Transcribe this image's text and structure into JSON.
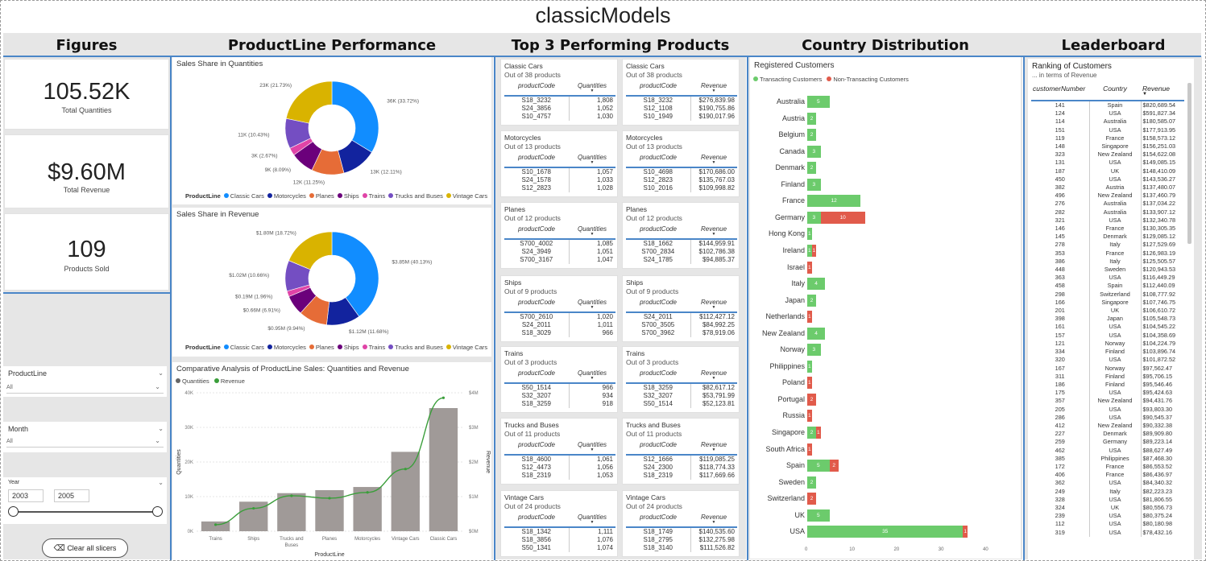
{
  "app_title": "classicModels",
  "headers": {
    "figures": "Figures",
    "productline": "ProductLine Performance",
    "top3": "Top 3 Performing Products",
    "country": "Country Distribution",
    "leaderboard": "Leaderboard"
  },
  "kpis": [
    {
      "value": "105.52K",
      "label": "Total Quantities"
    },
    {
      "value": "$9.60M",
      "label": "Total Revenue"
    },
    {
      "value": "109",
      "label": "Products Sold"
    }
  ],
  "slicers": {
    "productline": {
      "label": "ProductLine",
      "value": "All"
    },
    "month": {
      "label": "Month",
      "value": "All"
    },
    "year": {
      "label": "Year",
      "from": "2003",
      "to": "2005"
    },
    "clear_button": "Clear all slicers"
  },
  "legend_title": "ProductLine",
  "legend_items": [
    {
      "name": "Classic Cars",
      "color": "#118DFF"
    },
    {
      "name": "Motorcycles",
      "color": "#12239E"
    },
    {
      "name": "Planes",
      "color": "#E66C37"
    },
    {
      "name": "Ships",
      "color": "#6B007B"
    },
    {
      "name": "Trains",
      "color": "#E044A7"
    },
    {
      "name": "Trucks and Buses",
      "color": "#744EC2"
    },
    {
      "name": "Vintage Cars",
      "color": "#D9B300"
    }
  ],
  "chart_data": [
    {
      "type": "pie",
      "title": "Sales Share in Quantities",
      "labels": [
        "Classic Cars",
        "Motorcycles",
        "Planes",
        "Ships",
        "Trains",
        "Trucks and Buses",
        "Vintage Cars"
      ],
      "values": [
        33.72,
        12.11,
        11.25,
        8.09,
        2.67,
        10.43,
        21.73
      ],
      "data_labels": [
        "36K (33.72%)",
        "13K (12.11%)",
        "12K (11.25%)",
        "9K (8.09%)",
        "3K (2.67%)",
        "11K (10.43%)",
        "23K (21.73%)"
      ]
    },
    {
      "type": "pie",
      "title": "Sales Share in Revenue",
      "labels": [
        "Classic Cars",
        "Motorcycles",
        "Planes",
        "Ships",
        "Trains",
        "Trucks and Buses",
        "Vintage Cars"
      ],
      "values": [
        40.13,
        11.68,
        9.94,
        6.91,
        1.96,
        10.66,
        18.72
      ],
      "data_labels": [
        "$3.85M (40.13%)",
        "$1.12M (11.68%)",
        "$0.95M (9.94%)",
        "$0.66M (6.91%)",
        "$0.19M (1.96%)",
        "$1.02M (10.66%)",
        "$1.80M (18.72%)"
      ]
    },
    {
      "type": "bar",
      "title": "Comparative Analysis of ProductLine Sales: Quantities and Revenue",
      "categories": [
        "Trains",
        "Ships",
        "Trucks and Buses",
        "Planes",
        "Motorcycles",
        "Vintage Cars",
        "Classic Cars"
      ],
      "series": [
        {
          "name": "Quantities",
          "values": [
            2818,
            8532,
            11001,
            11872,
            12778,
            22933,
            35582
          ]
        },
        {
          "name": "Revenue",
          "values": [
            188532,
            661622,
            1024113,
            954637,
            1121426,
            1797560,
            3853922
          ]
        }
      ],
      "xlabel": "ProductLine",
      "ylabel": "Quantities",
      "y2label": "Revenue",
      "ylim": [
        0,
        40000
      ],
      "y2lim": [
        0,
        4000000
      ],
      "yticks": [
        "0K",
        "10K",
        "20K",
        "30K",
        "40K"
      ],
      "y2ticks": [
        "$0M",
        "$1M",
        "$2M",
        "$3M",
        "$4M"
      ]
    },
    {
      "type": "bar",
      "title": "Registered Customers",
      "series": [
        {
          "name": "Transacting Customers",
          "color": "#6CCB6C"
        },
        {
          "name": "Non-Transacting Customers",
          "color": "#E15B4B"
        }
      ],
      "categories": [
        "Australia",
        "Austria",
        "Belgium",
        "Canada",
        "Denmark",
        "Finland",
        "France",
        "Germany",
        "Hong Kong",
        "Ireland",
        "Israel",
        "Italy",
        "Japan",
        "Netherlands",
        "New Zealand",
        "Norway",
        "Philippines",
        "Poland",
        "Portugal",
        "Russia",
        "Singapore",
        "South Africa",
        "Spain",
        "Sweden",
        "Switzerland",
        "UK",
        "USA"
      ],
      "transacting": [
        5,
        2,
        2,
        3,
        2,
        3,
        12,
        3,
        1,
        1,
        0,
        4,
        2,
        0,
        4,
        3,
        1,
        0,
        0,
        0,
        2,
        0,
        5,
        2,
        0,
        5,
        35
      ],
      "non_transacting": [
        0,
        0,
        0,
        0,
        0,
        0,
        0,
        10,
        0,
        1,
        1,
        0,
        0,
        1,
        0,
        0,
        0,
        1,
        2,
        1,
        1,
        1,
        2,
        0,
        2,
        0,
        1
      ],
      "xlim": [
        0,
        40
      ],
      "xticks": [
        "0",
        "10",
        "20",
        "30",
        "40"
      ]
    }
  ],
  "top3": {
    "columns": [
      [
        {
          "title": "Classic Cars",
          "sub": "Out of 38 products",
          "metric": "Quantities",
          "rows": [
            [
              "S18_3232",
              "1,808"
            ],
            [
              "S24_3856",
              "1,052"
            ],
            [
              "S10_4757",
              "1,030"
            ]
          ]
        },
        {
          "title": "Motorcycles",
          "sub": "Out of 13 products",
          "metric": "Quantities",
          "rows": [
            [
              "S10_1678",
              "1,057"
            ],
            [
              "S24_1578",
              "1,033"
            ],
            [
              "S12_2823",
              "1,028"
            ]
          ]
        },
        {
          "title": "Planes",
          "sub": "Out of 12 products",
          "metric": "Quantities",
          "rows": [
            [
              "S700_4002",
              "1,085"
            ],
            [
              "S24_3949",
              "1,051"
            ],
            [
              "S700_3167",
              "1,047"
            ]
          ]
        },
        {
          "title": "Ships",
          "sub": "Out of 9 products",
          "metric": "Quantities",
          "rows": [
            [
              "S700_2610",
              "1,020"
            ],
            [
              "S24_2011",
              "1,011"
            ],
            [
              "S18_3029",
              "966"
            ]
          ]
        },
        {
          "title": "Trains",
          "sub": "Out of 3 products",
          "metric": "Quantities",
          "rows": [
            [
              "S50_1514",
              "966"
            ],
            [
              "S32_3207",
              "934"
            ],
            [
              "S18_3259",
              "918"
            ]
          ]
        },
        {
          "title": "Trucks and Buses",
          "sub": "Out of 11 products",
          "metric": "Quantities",
          "rows": [
            [
              "S18_4600",
              "1,061"
            ],
            [
              "S12_4473",
              "1,056"
            ],
            [
              "S18_2319",
              "1,053"
            ]
          ]
        },
        {
          "title": "Vintage Cars",
          "sub": "Out of 24 products",
          "metric": "Quantities",
          "rows": [
            [
              "S18_1342",
              "1,111"
            ],
            [
              "S18_3856",
              "1,076"
            ],
            [
              "S50_1341",
              "1,074"
            ]
          ]
        }
      ],
      [
        {
          "title": "Classic Cars",
          "sub": "Out of 38 products",
          "metric": "Revenue",
          "rows": [
            [
              "S18_3232",
              "$276,839.98"
            ],
            [
              "S12_1108",
              "$190,755.86"
            ],
            [
              "S10_1949",
              "$190,017.96"
            ]
          ]
        },
        {
          "title": "Motorcycles",
          "sub": "Out of 13 products",
          "metric": "Revenue",
          "rows": [
            [
              "S10_4698",
              "$170,686.00"
            ],
            [
              "S12_2823",
              "$135,767.03"
            ],
            [
              "S10_2016",
              "$109,998.82"
            ]
          ]
        },
        {
          "title": "Planes",
          "sub": "Out of 12 products",
          "metric": "Revenue",
          "rows": [
            [
              "S18_1662",
              "$144,959.91"
            ],
            [
              "S700_2834",
              "$102,786.38"
            ],
            [
              "S24_1785",
              "$94,885.37"
            ]
          ]
        },
        {
          "title": "Ships",
          "sub": "Out of 9 products",
          "metric": "Revenue",
          "rows": [
            [
              "S24_2011",
              "$112,427.12"
            ],
            [
              "S700_3505",
              "$84,992.25"
            ],
            [
              "S700_3962",
              "$78,919.06"
            ]
          ]
        },
        {
          "title": "Trains",
          "sub": "Out of 3 products",
          "metric": "Revenue",
          "rows": [
            [
              "S18_3259",
              "$82,617.12"
            ],
            [
              "S32_3207",
              "$53,791.99"
            ],
            [
              "S50_1514",
              "$52,123.81"
            ]
          ]
        },
        {
          "title": "Trucks and Buses",
          "sub": "Out of 11 products",
          "metric": "Revenue",
          "rows": [
            [
              "S12_1666",
              "$119,085.25"
            ],
            [
              "S24_2300",
              "$118,774.33"
            ],
            [
              "S18_2319",
              "$117,669.66"
            ]
          ]
        },
        {
          "title": "Vintage Cars",
          "sub": "Out of 24 products",
          "metric": "Revenue",
          "rows": [
            [
              "S18_1749",
              "$140,535.60"
            ],
            [
              "S18_2795",
              "$132,275.98"
            ],
            [
              "S18_3140",
              "$111,526.82"
            ]
          ]
        }
      ]
    ],
    "code_header": "productCode"
  },
  "leaderboard": {
    "title": "Ranking of Customers",
    "subtitle": "... in terms of Revenue",
    "columns": [
      "customerNumber",
      "Country",
      "Revenue"
    ],
    "rows": [
      [
        "141",
        "Spain",
        "$820,689.54"
      ],
      [
        "124",
        "USA",
        "$591,827.34"
      ],
      [
        "114",
        "Australia",
        "$180,585.07"
      ],
      [
        "151",
        "USA",
        "$177,913.95"
      ],
      [
        "119",
        "France",
        "$158,573.12"
      ],
      [
        "148",
        "Singapore",
        "$156,251.03"
      ],
      [
        "323",
        "New Zealand",
        "$154,622.08"
      ],
      [
        "131",
        "USA",
        "$149,085.15"
      ],
      [
        "187",
        "UK",
        "$148,410.09"
      ],
      [
        "450",
        "USA",
        "$143,536.27"
      ],
      [
        "382",
        "Austria",
        "$137,480.07"
      ],
      [
        "496",
        "New Zealand",
        "$137,460.79"
      ],
      [
        "276",
        "Australia",
        "$137,034.22"
      ],
      [
        "282",
        "Australia",
        "$133,907.12"
      ],
      [
        "321",
        "USA",
        "$132,340.78"
      ],
      [
        "146",
        "France",
        "$130,305.35"
      ],
      [
        "145",
        "Denmark",
        "$129,085.12"
      ],
      [
        "278",
        "Italy",
        "$127,529.69"
      ],
      [
        "353",
        "France",
        "$126,983.19"
      ],
      [
        "386",
        "Italy",
        "$125,505.57"
      ],
      [
        "448",
        "Sweden",
        "$120,943.53"
      ],
      [
        "363",
        "USA",
        "$116,449.29"
      ],
      [
        "458",
        "Spain",
        "$112,440.09"
      ],
      [
        "298",
        "Switzerland",
        "$108,777.92"
      ],
      [
        "166",
        "Singapore",
        "$107,746.75"
      ],
      [
        "201",
        "UK",
        "$106,610.72"
      ],
      [
        "398",
        "Japan",
        "$105,548.73"
      ],
      [
        "161",
        "USA",
        "$104,545.22"
      ],
      [
        "157",
        "USA",
        "$104,358.69"
      ],
      [
        "121",
        "Norway",
        "$104,224.79"
      ],
      [
        "334",
        "Finland",
        "$103,896.74"
      ],
      [
        "320",
        "USA",
        "$101,872.52"
      ],
      [
        "167",
        "Norway",
        "$97,562.47"
      ],
      [
        "311",
        "Finland",
        "$95,706.15"
      ],
      [
        "186",
        "Finland",
        "$95,546.46"
      ],
      [
        "175",
        "USA",
        "$95,424.63"
      ],
      [
        "357",
        "New Zealand",
        "$94,431.76"
      ],
      [
        "205",
        "USA",
        "$93,803.30"
      ],
      [
        "286",
        "USA",
        "$90,545.37"
      ],
      [
        "412",
        "New Zealand",
        "$90,332.38"
      ],
      [
        "227",
        "Denmark",
        "$89,909.80"
      ],
      [
        "259",
        "Germany",
        "$89,223.14"
      ],
      [
        "462",
        "USA",
        "$88,627.49"
      ],
      [
        "385",
        "Philippines",
        "$87,468.30"
      ],
      [
        "172",
        "France",
        "$86,553.52"
      ],
      [
        "406",
        "France",
        "$86,436.97"
      ],
      [
        "362",
        "USA",
        "$84,340.32"
      ],
      [
        "249",
        "Italy",
        "$82,223.23"
      ],
      [
        "328",
        "USA",
        "$81,806.55"
      ],
      [
        "324",
        "UK",
        "$80,556.73"
      ],
      [
        "239",
        "USA",
        "$80,375.24"
      ],
      [
        "112",
        "USA",
        "$80,180.98"
      ],
      [
        "319",
        "USA",
        "$78,432.16"
      ]
    ]
  }
}
